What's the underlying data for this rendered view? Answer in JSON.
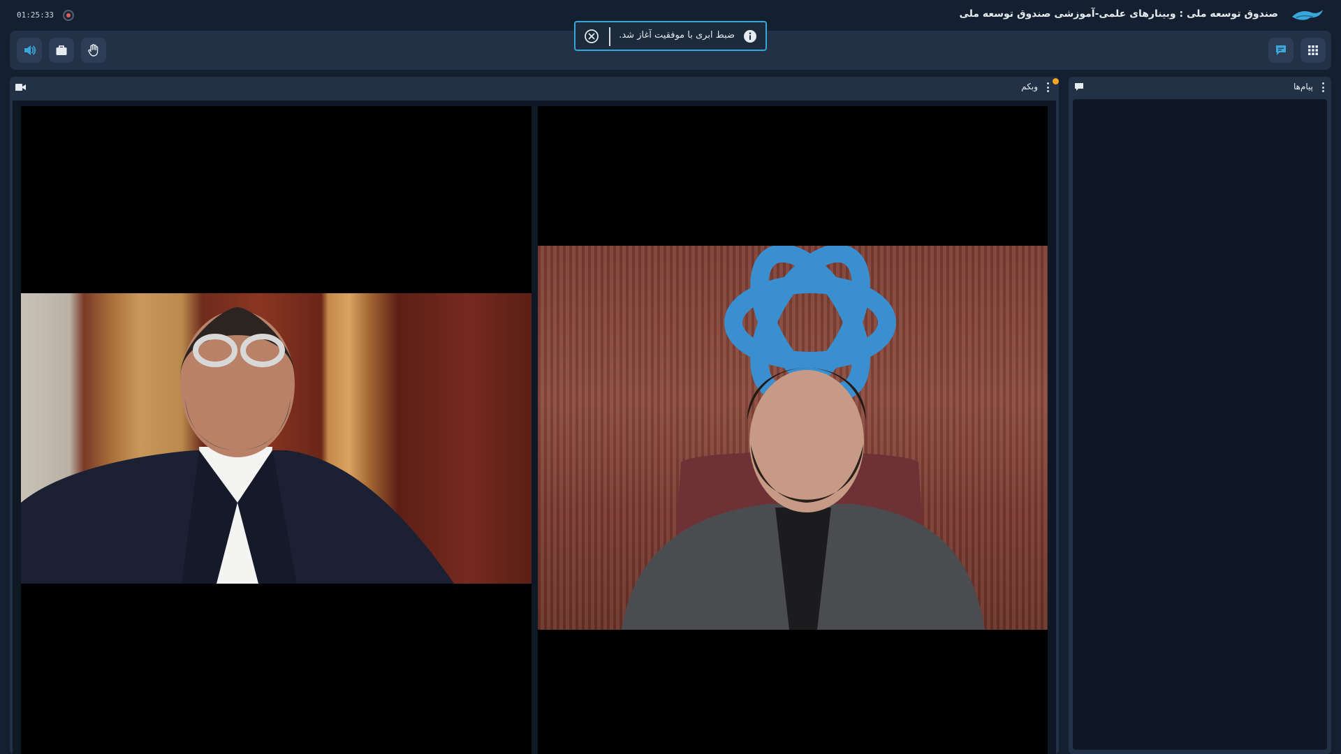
{
  "window": {
    "timer": "01:25:33",
    "title": "صندوق توسعه ملی : وبینارهای علمی-آموزشی صندوق توسعه ملی"
  },
  "toast": {
    "message": "ضبط ابری با موفقیت آغاز شد."
  },
  "toolbar": {
    "left_buttons": [
      "speaker-icon",
      "briefcase-icon",
      "raise-hand-icon"
    ],
    "right_buttons": [
      "chat-icon",
      "apps-grid-icon"
    ]
  },
  "webcam_panel": {
    "title": "وبکم",
    "tiles": [
      "participant-video-1",
      "participant-video-2"
    ]
  },
  "messages_panel": {
    "title": "پیام‌ها"
  },
  "colors": {
    "background": "#14202f",
    "panel": "#223146",
    "accent": "#35a9d8",
    "notify": "#f5a623",
    "record": "#e05a5a"
  }
}
